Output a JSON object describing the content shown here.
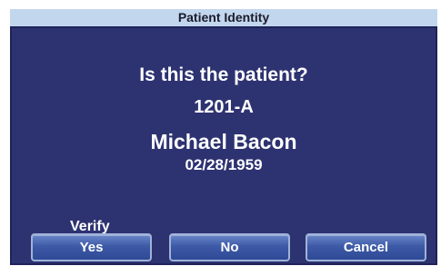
{
  "window": {
    "title": "Patient Identity"
  },
  "prompt": {
    "question": "Is this the patient?",
    "patient_id": "1201-A",
    "patient_name": "Michael Bacon",
    "date_of_birth": "02/28/1959"
  },
  "actions": {
    "verify_label": "Verify",
    "yes_label": "Yes",
    "no_label": "No",
    "cancel_label": "Cancel"
  },
  "colors": {
    "dialog_background": "#2d3271",
    "title_bar_background": "#c2d6ee",
    "button_gradient_top": "#6b86c8",
    "button_gradient_bottom": "#2f4a96"
  }
}
